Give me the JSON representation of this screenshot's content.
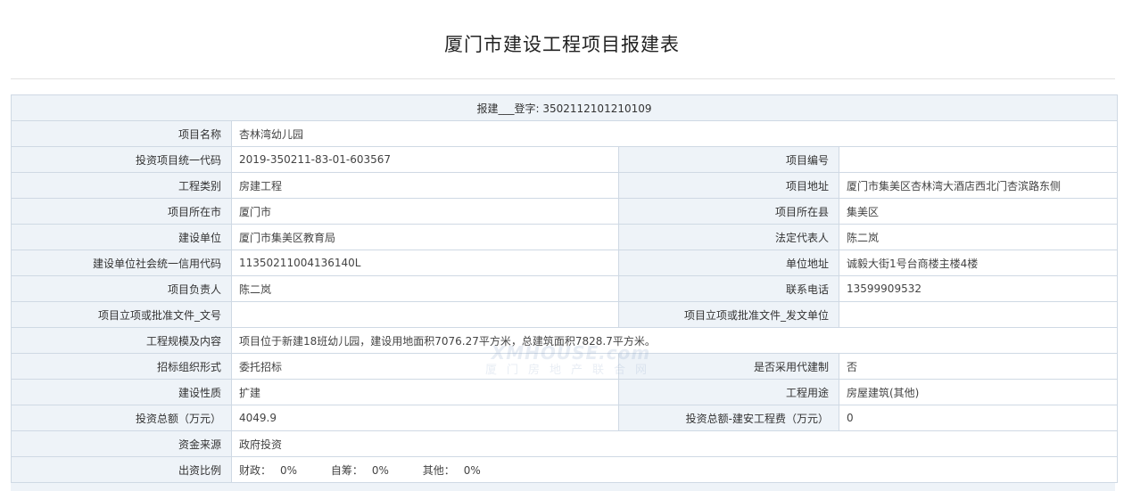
{
  "title": "厦门市建设工程项目报建表",
  "registration": "报建___登字: 3502112101210109",
  "rows": {
    "project_name": {
      "label": "项目名称",
      "value": "杏林湾幼儿园"
    },
    "invest_code": {
      "label": "投资项目统一代码",
      "value": "2019-350211-83-01-603567"
    },
    "project_no": {
      "label": "项目编号",
      "value": ""
    },
    "eng_category": {
      "label": "工程类别",
      "value": "房建工程"
    },
    "project_address": {
      "label": "项目地址",
      "value": "厦门市集美区杏林湾大酒店西北门杏滨路东侧"
    },
    "city": {
      "label": "项目所在市",
      "value": "厦门市"
    },
    "county": {
      "label": "项目所在县",
      "value": "集美区"
    },
    "builder": {
      "label": "建设单位",
      "value": "厦门市集美区教育局"
    },
    "legal_rep": {
      "label": "法定代表人",
      "value": "陈二岚"
    },
    "credit_code": {
      "label": "建设单位社会统一信用代码",
      "value": "11350211004136140L"
    },
    "unit_address": {
      "label": "单位地址",
      "value": "诚毅大街1号台商楼主楼4楼"
    },
    "project_lead": {
      "label": "项目负责人",
      "value": "陈二岚"
    },
    "phone": {
      "label": "联系电话",
      "value": "13599909532"
    },
    "approval_doc_no": {
      "label": "项目立项或批准文件_文号",
      "value": ""
    },
    "approval_issuer": {
      "label": "项目立项或批准文件_发文单位",
      "value": ""
    },
    "scale": {
      "label": "工程规模及内容",
      "value": "项目位于新建18班幼儿园，建设用地面积7076.27平方米，总建筑面积7828.7平方米。"
    },
    "tender_form": {
      "label": "招标组织形式",
      "value": "委托招标"
    },
    "agent_system": {
      "label": "是否采用代建制",
      "value": "否"
    },
    "build_nature": {
      "label": "建设性质",
      "value": "扩建"
    },
    "purpose": {
      "label": "工程用途",
      "value": "房屋建筑(其他)"
    },
    "total_invest": {
      "label": "投资总额（万元）",
      "value": "4049.9"
    },
    "construct_fee": {
      "label": "投资总额-建安工程费（万元）",
      "value": "0"
    },
    "fund_source": {
      "label": "资金来源",
      "value": "政府投资"
    },
    "fund_ratio": {
      "label": "出资比例",
      "parts": [
        {
          "name": "财政：",
          "value": "0%"
        },
        {
          "name": "自筹：",
          "value": "0%"
        },
        {
          "name": "其他：",
          "value": "0%"
        }
      ]
    }
  },
  "watermark": {
    "top": "XMHOUSE.com",
    "bottom": "厦门房地产联合网"
  }
}
